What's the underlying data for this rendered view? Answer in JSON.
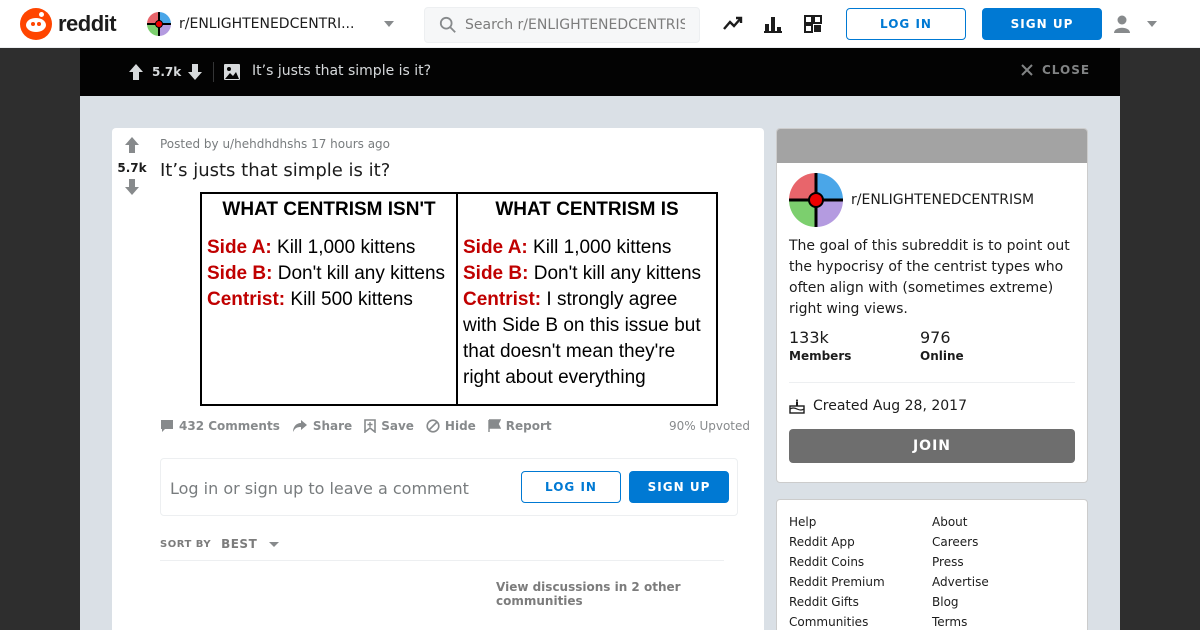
{
  "nav": {
    "logo_text": "reddit",
    "subreddit": "r/ENLIGHTENEDCENTRI...",
    "search_placeholder": "Search r/ENLIGHTENEDCENTRISM",
    "login": "LOG IN",
    "signup": "SIGN UP"
  },
  "post_header": {
    "score": "5.7k",
    "title": "It’s justs that simple is it?",
    "close": "CLOSE"
  },
  "post": {
    "score": "5.7k",
    "meta": "Posted by u/hehdhdhshs 17 hours ago",
    "title": "It’s justs that simple is it?",
    "image": {
      "left_header": "WHAT CENTRISM ISN'T",
      "right_header": "WHAT CENTRISM IS",
      "left_lines": [
        {
          "label": "Side A:",
          "text": " Kill 1,000 kittens"
        },
        {
          "label": "Side B:",
          "text": " Don't kill any kittens"
        },
        {
          "label": "Centrist:",
          "text": " Kill 500 kittens"
        }
      ],
      "right_lines": [
        {
          "label": "Side A:",
          "text": " Kill 1,000 kittens"
        },
        {
          "label": "Side B:",
          "text": " Don't kill any kittens"
        },
        {
          "label": "Centrist:",
          "text": " I strongly agree with Side B on this issue but that doesn't mean they're right about everything"
        }
      ]
    },
    "actions": {
      "comments": "432 Comments",
      "share": "Share",
      "save": "Save",
      "hide": "Hide",
      "report": "Report",
      "upvoted": "90% Upvoted"
    },
    "comment_prompt": "Log in or sign up to leave a comment",
    "comment_login": "LOG IN",
    "comment_signup": "SIGN UP",
    "sort_by": "SORT BY",
    "sort_value": "BEST",
    "view_discussions": "View discussions in 2 other communities"
  },
  "about": {
    "name": "r/ENLIGHTENEDCENTRISM",
    "description": "The goal of this subreddit is to point out the hypocrisy of the centrist types who often align with (sometimes extreme) right wing views.",
    "members_count": "133k",
    "members_label": "Members",
    "online_count": "976",
    "online_label": "Online",
    "created": "Created Aug 28, 2017",
    "join": "JOIN"
  },
  "footer_links": {
    "left": [
      "Help",
      "Reddit App",
      "Reddit Coins",
      "Reddit Premium",
      "Reddit Gifts",
      "Communities"
    ],
    "right": [
      "About",
      "Careers",
      "Press",
      "Advertise",
      "Blog",
      "Terms"
    ]
  },
  "colors": {
    "brand": "#ff4500",
    "accent": "#0079d3",
    "meme_red": "#c00000"
  }
}
